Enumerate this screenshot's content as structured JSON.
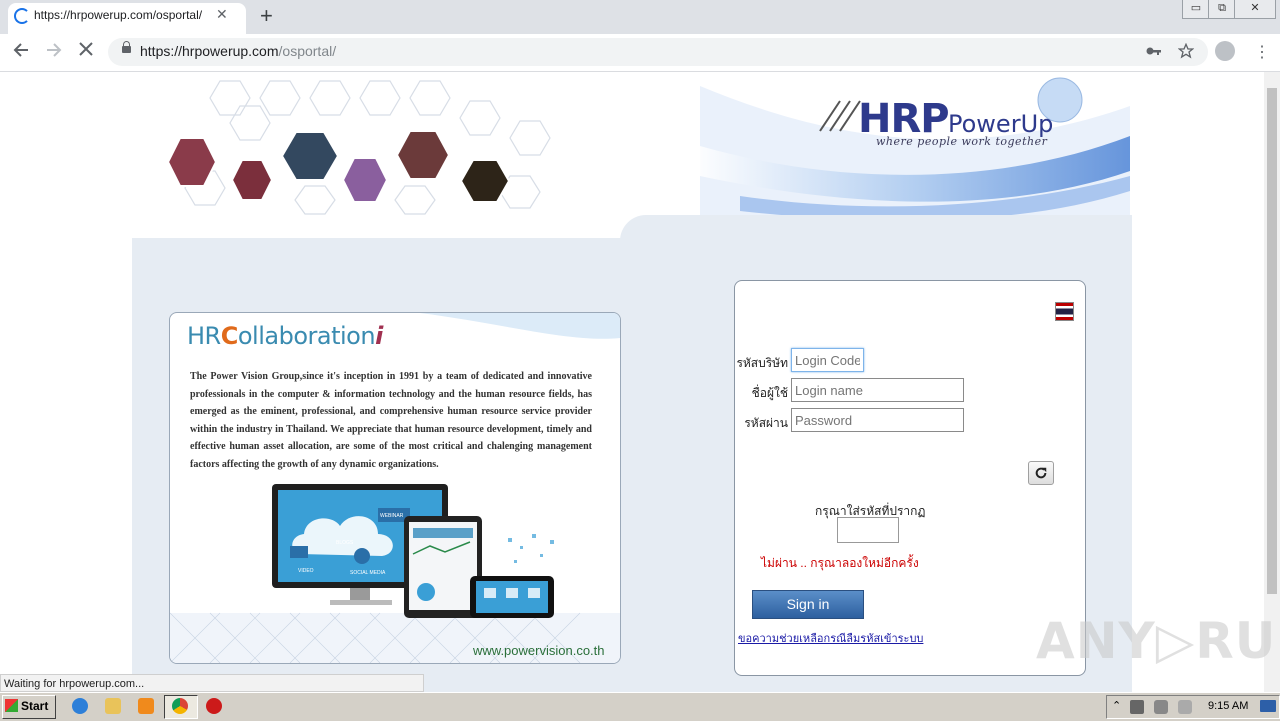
{
  "browser": {
    "tab_title": "https://hrpowerup.com/osportal/",
    "tab_close": "✕",
    "new_tab": "+",
    "url_host": "https://hrpowerup.com",
    "url_path": "/osportal/",
    "status_text": "Waiting for hrpowerup.com..."
  },
  "window": {
    "minimize": "▭",
    "restore": "⧉",
    "close": "✕"
  },
  "banner": {
    "logo_main": "HRP",
    "logo_sub": "PowerUp",
    "tagline": "where people work together"
  },
  "info_card": {
    "title_prefix": "HR",
    "title_c": "C",
    "title_rest": "ollaboration",
    "title_suffix": "i",
    "body": "The Power Vision Group,since it's inception in 1991 by a team of dedicated and innovative professionals in the computer & information technology and the human resource fields, has emerged as the eminent, professional, and comprehensive human resource service provider within the industry in Thailand. We appreciate that human resource development, timely and effective human asset allocation, are some of the most critical and chalenging management factors affecting the growth of any dynamic organizations.",
    "site_url": "www.powervision.co.th",
    "device_labels": [
      "BLOGS",
      "WEBINAR",
      "VIDEO",
      "SOCIAL MEDIA"
    ]
  },
  "login": {
    "company_label": "รหัสบริษัท",
    "company_placeholder": "Login Code",
    "username_label": "ชื่อผู้ใช้",
    "username_placeholder": "Login name",
    "password_label": "รหัสผ่าน",
    "password_placeholder": "Password",
    "captcha_label": "กรุณาใส่รหัสที่ปรากฏ",
    "error_text": "ไม่ผ่าน .. กรุณาลองใหม่อีกครั้ง",
    "signin_label": "Sign in",
    "help_link": "ขอความช่วยเหลือกรณีลืมรหัสเข้าระบบ"
  },
  "watermark": "ANY▷RUN",
  "taskbar": {
    "start_label": "Start",
    "clock": "9:15 AM"
  }
}
